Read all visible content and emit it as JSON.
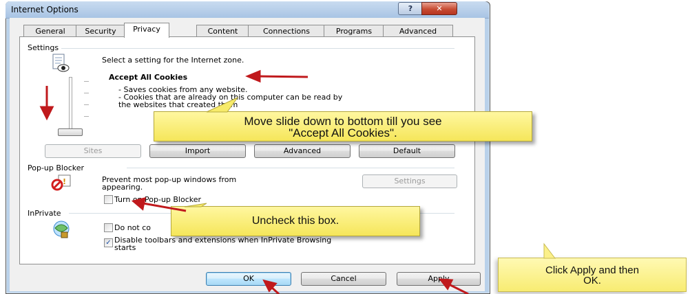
{
  "window": {
    "title": "Internet Options",
    "help_label": "?",
    "close_label": "✕"
  },
  "tabs": [
    {
      "label": "General"
    },
    {
      "label": "Security"
    },
    {
      "label": "Privacy"
    },
    {
      "label": "Content"
    },
    {
      "label": "Connections"
    },
    {
      "label": "Programs"
    },
    {
      "label": "Advanced"
    }
  ],
  "settings": {
    "group_label": "Settings",
    "intro": "Select a setting for the Internet zone.",
    "level_title": "Accept All Cookies",
    "desc_1": "- Saves cookies from any website.",
    "desc_2": "- Cookies that are already on this computer can be read by",
    "desc_3": "the websites that created them",
    "sites_label": "Sites",
    "import_label": "Import",
    "advanced_label": "Advanced",
    "default_label": "Default"
  },
  "popup": {
    "group_label": "Pop-up Blocker",
    "desc_1": "Prevent most pop-up windows from",
    "desc_2": "appearing.",
    "settings_label": "Settings",
    "turn_on_label": "Turn on Pop-up Blocker",
    "turn_on_checked": false
  },
  "inprivate": {
    "group_label": "InPrivate",
    "do_not_label": "Do not co",
    "disable_label_1": "Disable toolbars and extensions when InPrivate Browsing",
    "disable_label_2": "starts",
    "disable_checked": true
  },
  "footer": {
    "ok_label": "OK",
    "cancel_label": "Cancel",
    "apply_label": "Apply"
  },
  "callouts": {
    "slide_1": "Move slide down to bottom till you see",
    "slide_2": "\"Accept All Cookies\".",
    "uncheck": "Uncheck this box.",
    "apply_1": "Click Apply and then",
    "apply_2": "OK."
  },
  "colors": {
    "arrow": "#c0191c",
    "callout_fill": "#f5e65a",
    "title_bar": "#b9d1ea"
  }
}
